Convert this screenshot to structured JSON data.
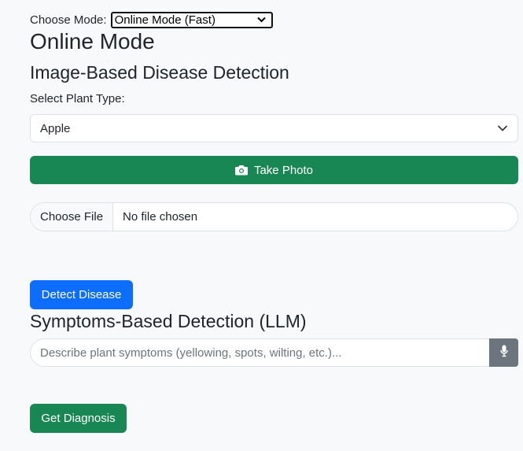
{
  "mode": {
    "label": "Choose Mode:",
    "selected": "Online Mode (Fast)"
  },
  "heading": "Online Mode",
  "image_section": {
    "title": "Image-Based Disease Detection",
    "plant_label": "Select Plant Type:",
    "plant_selected": "Apple",
    "take_photo_label": "Take Photo",
    "choose_file_label": "Choose File",
    "file_status": "No file chosen",
    "detect_label": "Detect Disease"
  },
  "symptoms_section": {
    "title": "Symptoms-Based Detection (LLM)",
    "placeholder": "Describe plant symptoms (yellowing, spots, wilting, etc.)...",
    "diagnosis_label": "Get Diagnosis"
  },
  "icons": {
    "camera": "camera-icon",
    "microphone": "microphone-icon",
    "chevron": "chevron-down-icon"
  },
  "colors": {
    "success": "#198754",
    "primary": "#0d6efd",
    "secondary": "#6c757d"
  }
}
